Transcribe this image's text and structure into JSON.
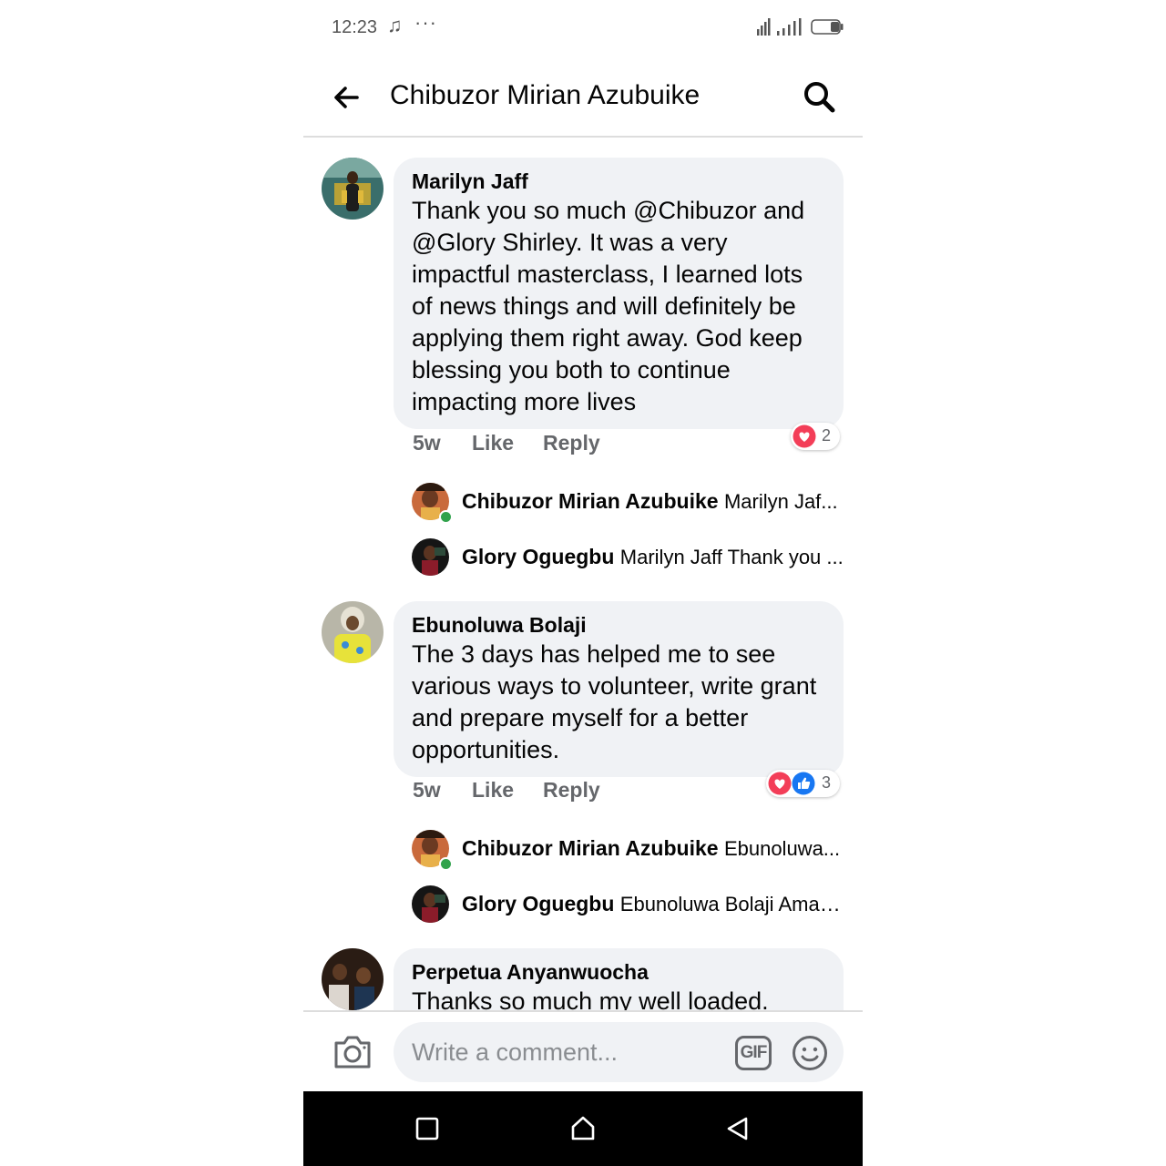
{
  "status_bar": {
    "time": "12:23",
    "music_icon": "music-note-icon",
    "more_dots": "···"
  },
  "header": {
    "title": "Chibuzor Mirian Azubuike"
  },
  "comments": [
    {
      "author": "Marilyn Jaff",
      "text": "Thank you so much @Chibuzor and @Glory Shirley. It was a very impactful masterclass, I learned lots of news things and will definitely be applying them right away. God keep blessing you both to continue impacting more lives",
      "time": "5w",
      "like_label": "Like",
      "reply_label": "Reply",
      "reactions": {
        "types": [
          "love"
        ],
        "count": "2"
      },
      "replies": [
        {
          "name": "Chibuzor Mirian Azubuike",
          "preview": "Marilyn Jaf...",
          "online": true
        },
        {
          "name": "Glory Oguegbu",
          "preview": "Marilyn Jaff Thank you ...",
          "online": false
        }
      ]
    },
    {
      "author": "Ebunoluwa Bolaji",
      "text": "The 3 days has helped me to see various ways to volunteer, write grant and prepare myself for a better opportunities.",
      "time": "5w",
      "like_label": "Like",
      "reply_label": "Reply",
      "reactions": {
        "types": [
          "love",
          "like"
        ],
        "count": "3"
      },
      "replies": [
        {
          "name": "Chibuzor Mirian Azubuike",
          "preview": "Ebunoluwa...",
          "online": true
        },
        {
          "name": "Glory Oguegbu",
          "preview": "Ebunoluwa Bolaji Amaz...",
          "online": false
        }
      ]
    },
    {
      "author": "Perpetua Anyanwuocha",
      "text": "Thanks so much my well loaded."
    }
  ],
  "composer": {
    "placeholder": "Write a comment...",
    "gif_label": "GIF"
  },
  "colors": {
    "bubble": "#f0f2f5",
    "love": "#f33e58",
    "like": "#1877f2",
    "online": "#31a24c",
    "meta": "#65676b"
  }
}
